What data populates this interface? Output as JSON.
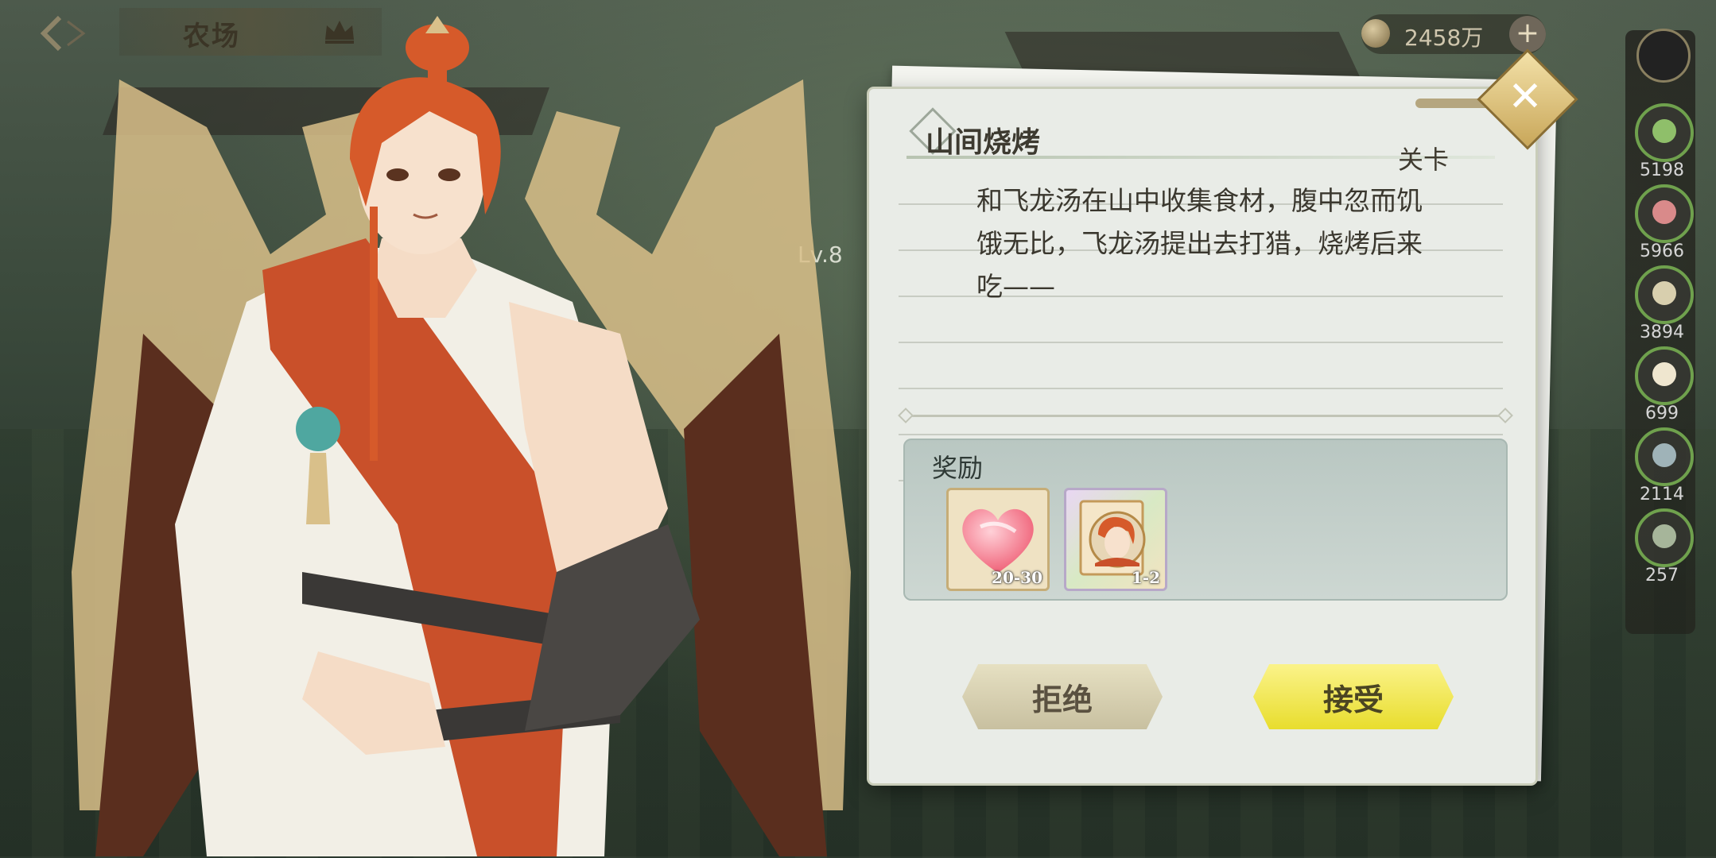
{
  "top_bar": {
    "title": "农场",
    "coin_value": "2458万",
    "plus_label": "+"
  },
  "scene": {
    "level_label": "Lv.8"
  },
  "resources": [
    {
      "name": "vegetable",
      "count": "5198",
      "color": "#8fbf6a"
    },
    {
      "name": "meat",
      "count": "5966",
      "color": "#d98a8a"
    },
    {
      "name": "grain",
      "count": "3894",
      "color": "#d8cfae"
    },
    {
      "name": "egg",
      "count": "699",
      "color": "#efe6cf"
    },
    {
      "name": "fish",
      "count": "2114",
      "color": "#9fb3b8"
    },
    {
      "name": "crab",
      "count": "257",
      "color": "#a6b59a"
    }
  ],
  "quest": {
    "title": "山间烧烤",
    "type": "关卡",
    "description": "和飞龙汤在山中收集食材，腹中忽而饥饿无比，飞龙汤提出去打猎，烧烤后来吃——",
    "reward_label": "奖励",
    "rewards": [
      {
        "name": "heart",
        "quantity": "20-30"
      },
      {
        "name": "character-card",
        "quantity": "1-2"
      }
    ],
    "decline_label": "拒绝",
    "accept_label": "接受"
  },
  "colors": {
    "accept": "#f1e847",
    "decline": "#d8d1b3",
    "dialog": "#e9ece7",
    "hair": "#d65a2a"
  }
}
